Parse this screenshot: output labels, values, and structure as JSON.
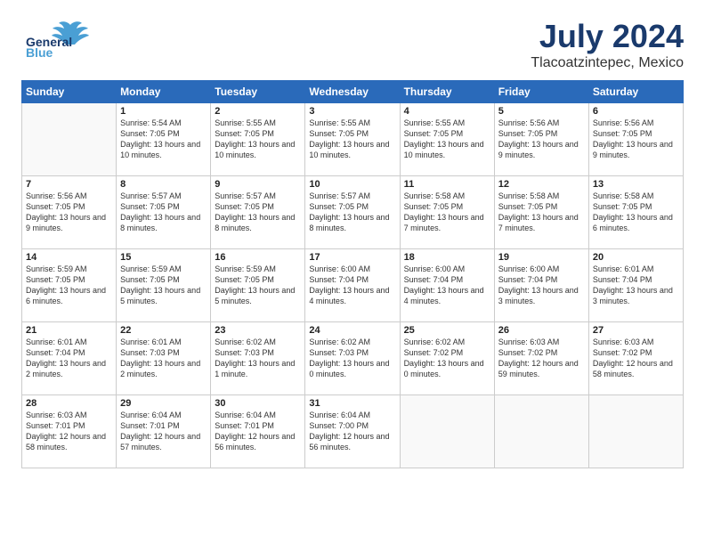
{
  "logo": {
    "line1": "General",
    "line2": "Blue"
  },
  "title": {
    "month": "July 2024",
    "location": "Tlacoatzintepec, Mexico"
  },
  "weekdays": [
    "Sunday",
    "Monday",
    "Tuesday",
    "Wednesday",
    "Thursday",
    "Friday",
    "Saturday"
  ],
  "weeks": [
    [
      {
        "day": "",
        "sunrise": "",
        "sunset": "",
        "daylight": ""
      },
      {
        "day": "1",
        "sunrise": "Sunrise: 5:54 AM",
        "sunset": "Sunset: 7:05 PM",
        "daylight": "Daylight: 13 hours and 10 minutes."
      },
      {
        "day": "2",
        "sunrise": "Sunrise: 5:55 AM",
        "sunset": "Sunset: 7:05 PM",
        "daylight": "Daylight: 13 hours and 10 minutes."
      },
      {
        "day": "3",
        "sunrise": "Sunrise: 5:55 AM",
        "sunset": "Sunset: 7:05 PM",
        "daylight": "Daylight: 13 hours and 10 minutes."
      },
      {
        "day": "4",
        "sunrise": "Sunrise: 5:55 AM",
        "sunset": "Sunset: 7:05 PM",
        "daylight": "Daylight: 13 hours and 10 minutes."
      },
      {
        "day": "5",
        "sunrise": "Sunrise: 5:56 AM",
        "sunset": "Sunset: 7:05 PM",
        "daylight": "Daylight: 13 hours and 9 minutes."
      },
      {
        "day": "6",
        "sunrise": "Sunrise: 5:56 AM",
        "sunset": "Sunset: 7:05 PM",
        "daylight": "Daylight: 13 hours and 9 minutes."
      }
    ],
    [
      {
        "day": "7",
        "sunrise": "Sunrise: 5:56 AM",
        "sunset": "Sunset: 7:05 PM",
        "daylight": "Daylight: 13 hours and 9 minutes."
      },
      {
        "day": "8",
        "sunrise": "Sunrise: 5:57 AM",
        "sunset": "Sunset: 7:05 PM",
        "daylight": "Daylight: 13 hours and 8 minutes."
      },
      {
        "day": "9",
        "sunrise": "Sunrise: 5:57 AM",
        "sunset": "Sunset: 7:05 PM",
        "daylight": "Daylight: 13 hours and 8 minutes."
      },
      {
        "day": "10",
        "sunrise": "Sunrise: 5:57 AM",
        "sunset": "Sunset: 7:05 PM",
        "daylight": "Daylight: 13 hours and 8 minutes."
      },
      {
        "day": "11",
        "sunrise": "Sunrise: 5:58 AM",
        "sunset": "Sunset: 7:05 PM",
        "daylight": "Daylight: 13 hours and 7 minutes."
      },
      {
        "day": "12",
        "sunrise": "Sunrise: 5:58 AM",
        "sunset": "Sunset: 7:05 PM",
        "daylight": "Daylight: 13 hours and 7 minutes."
      },
      {
        "day": "13",
        "sunrise": "Sunrise: 5:58 AM",
        "sunset": "Sunset: 7:05 PM",
        "daylight": "Daylight: 13 hours and 6 minutes."
      }
    ],
    [
      {
        "day": "14",
        "sunrise": "Sunrise: 5:59 AM",
        "sunset": "Sunset: 7:05 PM",
        "daylight": "Daylight: 13 hours and 6 minutes."
      },
      {
        "day": "15",
        "sunrise": "Sunrise: 5:59 AM",
        "sunset": "Sunset: 7:05 PM",
        "daylight": "Daylight: 13 hours and 5 minutes."
      },
      {
        "day": "16",
        "sunrise": "Sunrise: 5:59 AM",
        "sunset": "Sunset: 7:05 PM",
        "daylight": "Daylight: 13 hours and 5 minutes."
      },
      {
        "day": "17",
        "sunrise": "Sunrise: 6:00 AM",
        "sunset": "Sunset: 7:04 PM",
        "daylight": "Daylight: 13 hours and 4 minutes."
      },
      {
        "day": "18",
        "sunrise": "Sunrise: 6:00 AM",
        "sunset": "Sunset: 7:04 PM",
        "daylight": "Daylight: 13 hours and 4 minutes."
      },
      {
        "day": "19",
        "sunrise": "Sunrise: 6:00 AM",
        "sunset": "Sunset: 7:04 PM",
        "daylight": "Daylight: 13 hours and 3 minutes."
      },
      {
        "day": "20",
        "sunrise": "Sunrise: 6:01 AM",
        "sunset": "Sunset: 7:04 PM",
        "daylight": "Daylight: 13 hours and 3 minutes."
      }
    ],
    [
      {
        "day": "21",
        "sunrise": "Sunrise: 6:01 AM",
        "sunset": "Sunset: 7:04 PM",
        "daylight": "Daylight: 13 hours and 2 minutes."
      },
      {
        "day": "22",
        "sunrise": "Sunrise: 6:01 AM",
        "sunset": "Sunset: 7:03 PM",
        "daylight": "Daylight: 13 hours and 2 minutes."
      },
      {
        "day": "23",
        "sunrise": "Sunrise: 6:02 AM",
        "sunset": "Sunset: 7:03 PM",
        "daylight": "Daylight: 13 hours and 1 minute."
      },
      {
        "day": "24",
        "sunrise": "Sunrise: 6:02 AM",
        "sunset": "Sunset: 7:03 PM",
        "daylight": "Daylight: 13 hours and 0 minutes."
      },
      {
        "day": "25",
        "sunrise": "Sunrise: 6:02 AM",
        "sunset": "Sunset: 7:02 PM",
        "daylight": "Daylight: 13 hours and 0 minutes."
      },
      {
        "day": "26",
        "sunrise": "Sunrise: 6:03 AM",
        "sunset": "Sunset: 7:02 PM",
        "daylight": "Daylight: 12 hours and 59 minutes."
      },
      {
        "day": "27",
        "sunrise": "Sunrise: 6:03 AM",
        "sunset": "Sunset: 7:02 PM",
        "daylight": "Daylight: 12 hours and 58 minutes."
      }
    ],
    [
      {
        "day": "28",
        "sunrise": "Sunrise: 6:03 AM",
        "sunset": "Sunset: 7:01 PM",
        "daylight": "Daylight: 12 hours and 58 minutes."
      },
      {
        "day": "29",
        "sunrise": "Sunrise: 6:04 AM",
        "sunset": "Sunset: 7:01 PM",
        "daylight": "Daylight: 12 hours and 57 minutes."
      },
      {
        "day": "30",
        "sunrise": "Sunrise: 6:04 AM",
        "sunset": "Sunset: 7:01 PM",
        "daylight": "Daylight: 12 hours and 56 minutes."
      },
      {
        "day": "31",
        "sunrise": "Sunrise: 6:04 AM",
        "sunset": "Sunset: 7:00 PM",
        "daylight": "Daylight: 12 hours and 56 minutes."
      },
      {
        "day": "",
        "sunrise": "",
        "sunset": "",
        "daylight": ""
      },
      {
        "day": "",
        "sunrise": "",
        "sunset": "",
        "daylight": ""
      },
      {
        "day": "",
        "sunrise": "",
        "sunset": "",
        "daylight": ""
      }
    ]
  ]
}
